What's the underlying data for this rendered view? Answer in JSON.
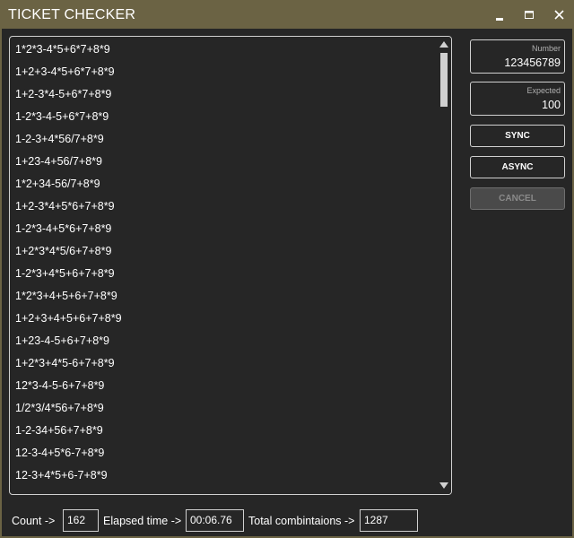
{
  "window": {
    "title": "TICKET CHECKER",
    "minimize_icon": "minimize-icon",
    "maximize_icon": "maximize-icon",
    "close_icon": "close-icon"
  },
  "results": {
    "items": [
      "1*2*3-4*5+6*7+8*9",
      "1+2+3-4*5+6*7+8*9",
      "1+2-3*4-5+6*7+8*9",
      "1-2*3-4-5+6*7+8*9",
      "1-2-3+4*56/7+8*9",
      "1+23-4+56/7+8*9",
      "1*2+34-56/7+8*9",
      "1+2-3*4+5*6+7+8*9",
      "1-2*3-4+5*6+7+8*9",
      "1+2*3*4*5/6+7+8*9",
      "1-2*3+4*5+6+7+8*9",
      "1*2*3+4+5+6+7+8*9",
      "1+2+3+4+5+6+7+8*9",
      "1+23-4-5+6+7+8*9",
      "1+2*3+4*5-6+7+8*9",
      "12*3-4-5-6+7+8*9",
      "1/2*3/4*56+7+8*9",
      "1-2-34+56+7+8*9",
      "12-3-4+5*6-7+8*9",
      "12-3+4*5+6-7+8*9"
    ]
  },
  "inputs": {
    "number_label": "Number",
    "number_value": "123456789",
    "expected_label": "Expected",
    "expected_value": "100"
  },
  "buttons": {
    "sync": "SYNC",
    "async": "ASYNC",
    "cancel": "CANCEL"
  },
  "status": {
    "count_label": "Count ->",
    "count_value": "162",
    "elapsed_label": "Elapsed time ->",
    "elapsed_value": "00:06.76",
    "total_label": "Total combintaions ->",
    "total_value": "1287"
  },
  "colors": {
    "titlebar": "#6b6344",
    "background": "#262626",
    "border": "#d0d0d0",
    "disabled_button": "#4a4a4a"
  }
}
